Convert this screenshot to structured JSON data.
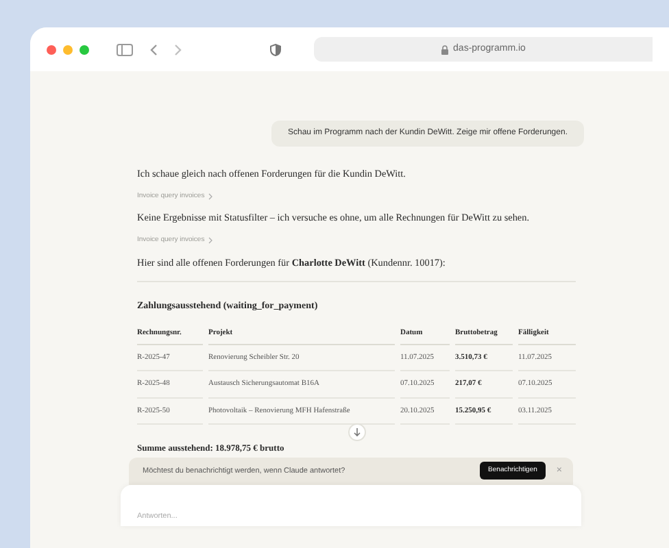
{
  "browser": {
    "url": "das-programm.io"
  },
  "user_message": "Schau im Programm nach der Kundin DeWitt. Zeige mir offene Forderungen.",
  "messages": [
    {
      "kind": "text",
      "text": "Ich schaue gleich nach offenen Forderungen für die Kundin DeWitt."
    },
    {
      "kind": "tool",
      "text": "Invoice query invoices"
    },
    {
      "kind": "text",
      "text": "Keine Ergebnisse mit Statusfilter – ich versuche es ohne, um alle Rechnungen für DeWitt zu sehen."
    },
    {
      "kind": "tool",
      "text": "Invoice query invoices"
    },
    {
      "kind": "text",
      "text": "Hier sind alle offenen Forderungen für **Charlotte DeWitt** (Kundennr. 10017):"
    }
  ],
  "table": {
    "title": "Zahlungsausstehend (waiting_for_payment)",
    "columns": [
      "Rechnungsnr.",
      "Projekt",
      "Datum",
      "Bruttobetrag",
      "Fälligkeit"
    ],
    "rows": [
      [
        "R-2025-47",
        "Renovierung Scheibler Str. 20",
        "11.07.2025",
        "3.510,73 €",
        "11.07.2025"
      ],
      [
        "R-2025-48",
        "Austausch Sicherungsautomat B16A",
        "07.10.2025",
        "217,07 €",
        "07.10.2025"
      ],
      [
        "R-2025-50",
        "Photovoltaik – Renovierung MFH Hafenstraße",
        "20.10.2025",
        "15.250,95 €",
        "03.11.2025"
      ]
    ]
  },
  "total": "Summe ausstehend: 18.978,75 € brutto",
  "notification": {
    "text": "Möchtest du benachrichtigt werden, wenn Claude antwortet?",
    "button": "Benachrichtigen",
    "close": "×"
  },
  "composer": {
    "placeholder": "Antworten..."
  }
}
